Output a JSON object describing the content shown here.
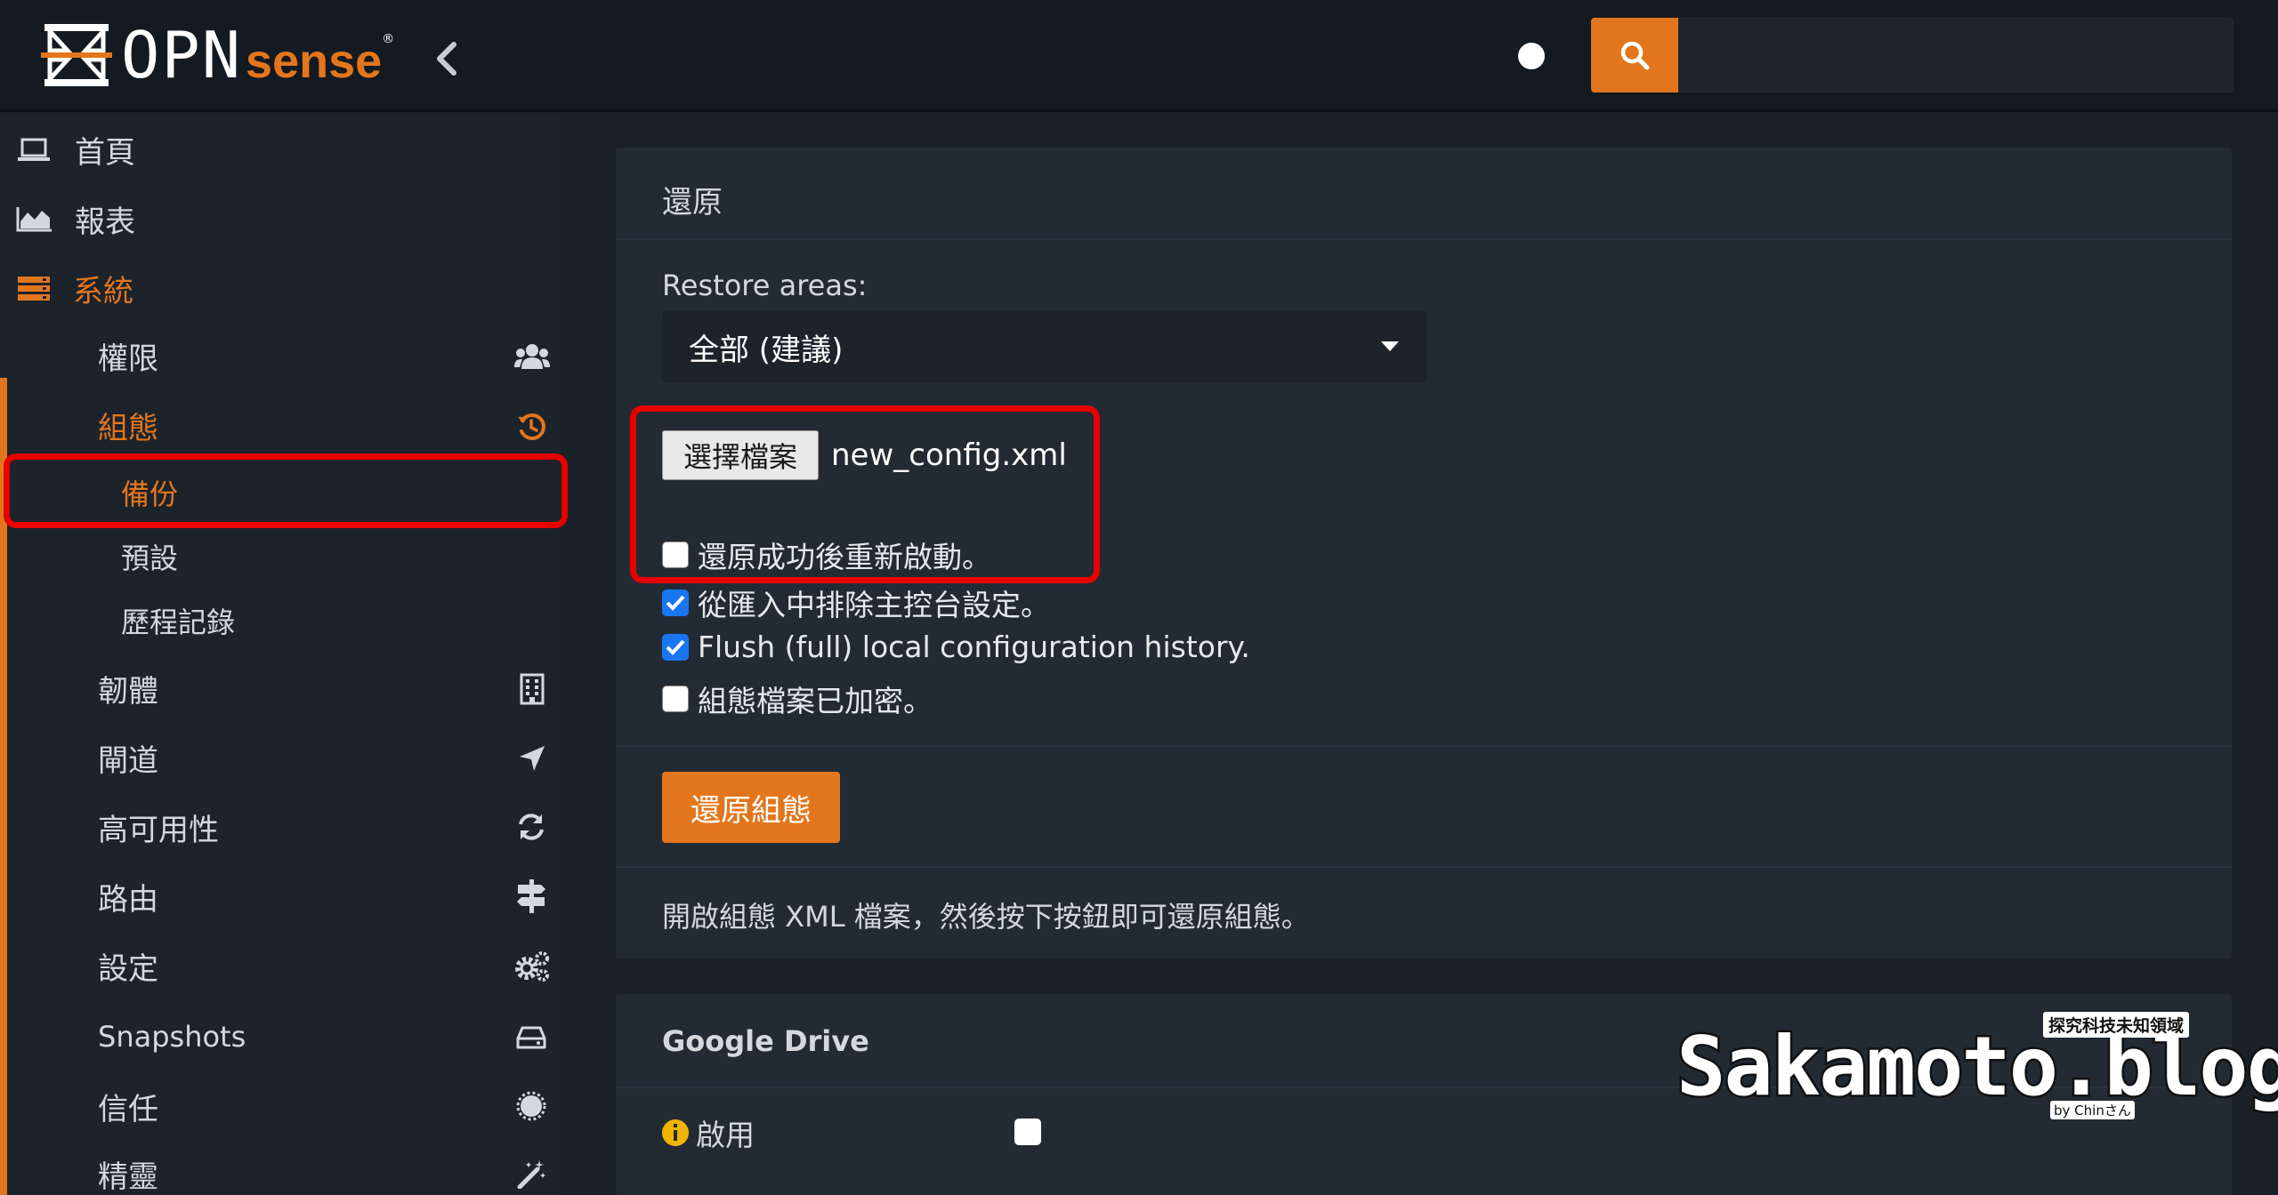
{
  "header": {
    "logo_primary": "OPN",
    "logo_secondary": "sense",
    "logo_mark": "®",
    "search_placeholder": ""
  },
  "sidebar": {
    "items": [
      {
        "label": "首頁",
        "icon": "laptop-icon"
      },
      {
        "label": "報表",
        "icon": "area-chart-icon"
      },
      {
        "label": "系統",
        "icon": "server-icon"
      },
      {
        "label": "權限",
        "icon": "users-icon"
      },
      {
        "label": "組態",
        "icon": "history-icon"
      },
      {
        "label": "備份"
      },
      {
        "label": "預設"
      },
      {
        "label": "歷程記錄"
      },
      {
        "label": "韌體",
        "icon": "building-icon"
      },
      {
        "label": "閘道",
        "icon": "location-arrow-icon"
      },
      {
        "label": "高可用性",
        "icon": "refresh-icon"
      },
      {
        "label": "路由",
        "icon": "signpost-icon"
      },
      {
        "label": "設定",
        "icon": "cogs-icon"
      },
      {
        "label": "Snapshots",
        "icon": "drive-icon"
      },
      {
        "label": "信任",
        "icon": "certificate-icon"
      },
      {
        "label": "精靈",
        "icon": "magic-icon"
      }
    ]
  },
  "restore": {
    "title": "還原",
    "areas_label": "Restore areas:",
    "areas_value": "全部 (建議)",
    "file_button": "選擇檔案",
    "file_name": "new_config.xml",
    "options": [
      {
        "label": "還原成功後重新啟動。",
        "checked": false
      },
      {
        "label": "從匯入中排除主控台設定。",
        "checked": true
      },
      {
        "label": "Flush (full) local configuration history.",
        "checked": true
      },
      {
        "label": "組態檔案已加密。",
        "checked": false
      }
    ],
    "submit_label": "還原組態",
    "help_text": "開啟組態 XML 檔案，然後按下按鈕即可還原組態。"
  },
  "google_drive": {
    "title": "Google Drive",
    "enable_label": "啟用",
    "enabled": false
  },
  "watermark": {
    "text": "Sakamoto.blog",
    "tag": "探究科技未知領域",
    "by": "by Chinさん"
  },
  "colors": {
    "accent": "#e3761c",
    "highlight": "#e60000",
    "checkbox_checked": "#1976f2"
  }
}
